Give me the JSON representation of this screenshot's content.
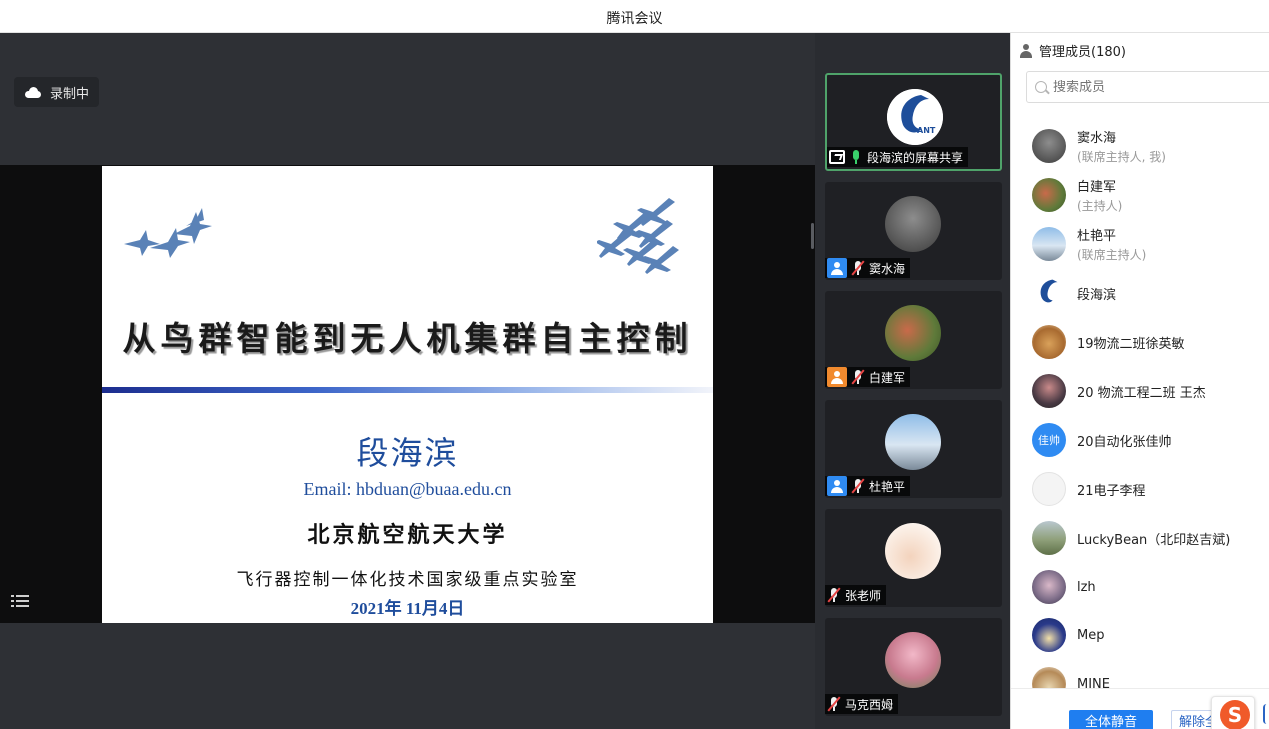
{
  "window": {
    "title": "腾讯会议"
  },
  "stage": {
    "recording_label": "录制中",
    "slide": {
      "title": "从鸟群智能到无人机集群自主控制",
      "author": "段海滨",
      "email": "Email: hbduan@buaa.edu.cn",
      "university": "北京航空航天大学",
      "lab": "飞行器控制一体化技术国家级重点实验室",
      "date": "2021年 11月4日"
    }
  },
  "videos": [
    {
      "label": "段海滨的屏幕共享",
      "badge": "screen-share",
      "mic": "on",
      "avatar_text": "ANT"
    },
    {
      "label": "窦水海",
      "badge": "blue",
      "mic": "off"
    },
    {
      "label": "白建军",
      "badge": "orange",
      "mic": "off"
    },
    {
      "label": "杜艳平",
      "badge": "blue",
      "mic": "off"
    },
    {
      "label": "张老师",
      "badge": "none",
      "mic": "off"
    },
    {
      "label": "马克西姆",
      "badge": "none",
      "mic": "off"
    }
  ],
  "members": {
    "title": "管理成员(180)",
    "search_placeholder": "搜索成员",
    "list": [
      {
        "name": "窦水海",
        "role": "(联席主持人, 我)"
      },
      {
        "name": "白建军",
        "role": "(主持人)"
      },
      {
        "name": "杜艳平",
        "role": "(联席主持人)"
      },
      {
        "name": "段海滨",
        "role": ""
      },
      {
        "name": "19物流二班徐英敏",
        "role": ""
      },
      {
        "name": "20 物流工程二班  王杰",
        "role": ""
      },
      {
        "name": "20自动化张佳帅",
        "role": "",
        "avatar_text": "佳帅"
      },
      {
        "name": "21电子李程",
        "role": ""
      },
      {
        "name": "LuckyBean（北印赵吉斌)",
        "role": ""
      },
      {
        "name": "lzh",
        "role": ""
      },
      {
        "name": "Mep",
        "role": ""
      },
      {
        "name": "MINE",
        "role": ""
      }
    ],
    "mute_all_label": "全体静音",
    "unmute_all_label": "解除全"
  },
  "colors": {
    "accent_blue": "#1f7ef0",
    "mic_on_green": "#39d06b",
    "mic_off_red": "#e84545",
    "slide_blue_text": "#1f4d9c"
  }
}
